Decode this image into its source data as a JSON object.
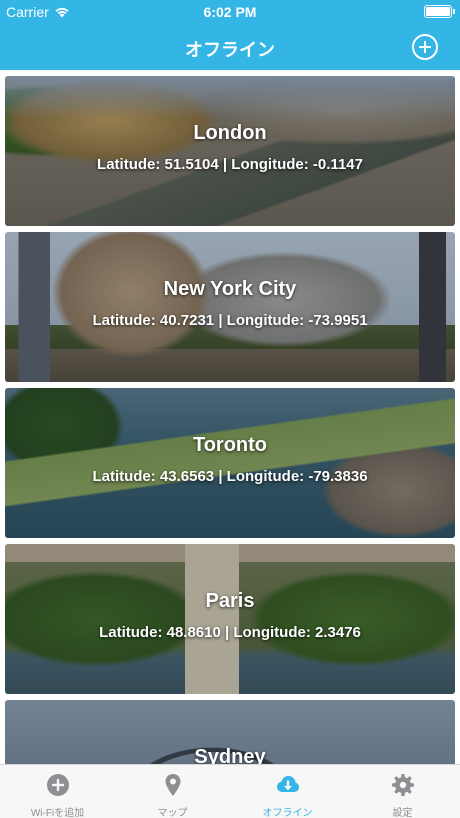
{
  "status_bar": {
    "carrier": "Carrier",
    "time": "6:02 PM"
  },
  "nav": {
    "title": "オフライン"
  },
  "cities": [
    {
      "name": "London",
      "coords": "Latitude: 51.5104 | Longitude: -0.1147"
    },
    {
      "name": "New York City",
      "coords": "Latitude: 40.7231 | Longitude: -73.9951"
    },
    {
      "name": "Toronto",
      "coords": "Latitude: 43.6563 | Longitude: -79.3836"
    },
    {
      "name": "Paris",
      "coords": "Latitude: 48.8610 | Longitude: 2.3476"
    },
    {
      "name": "Sydney",
      "coords": ""
    }
  ],
  "tabs": [
    {
      "label": "Wi-Fiを追加",
      "icon": "plus-circle-icon"
    },
    {
      "label": "マップ",
      "icon": "map-pin-icon"
    },
    {
      "label": "オフライン",
      "icon": "cloud-download-icon",
      "active": true
    },
    {
      "label": "設定",
      "icon": "gear-icon"
    }
  ],
  "colors": {
    "accent": "#33b5e5",
    "tab_inactive": "#8e8e93",
    "tab_bar_bg": "#f7f7f7"
  }
}
